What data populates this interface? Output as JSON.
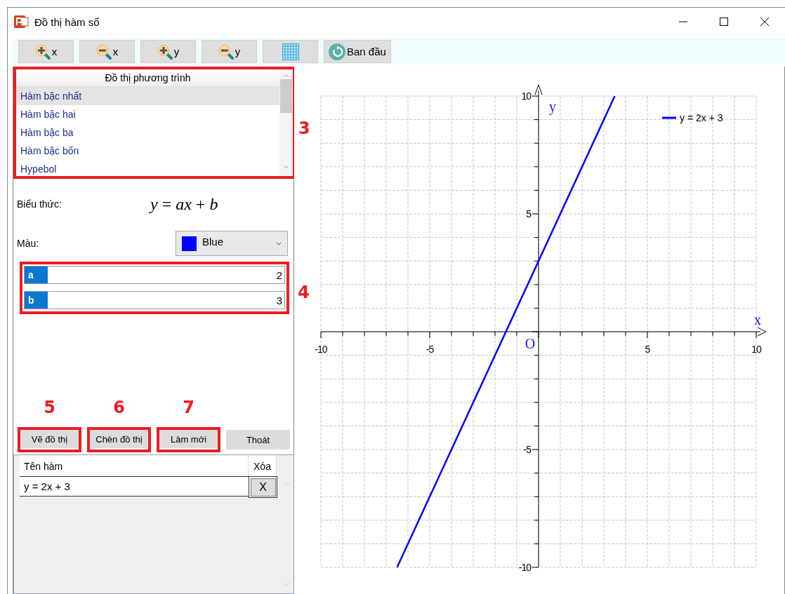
{
  "window": {
    "title": "Đồ thị hàm số"
  },
  "toolbar": [
    {
      "kind": "zoom-in",
      "label": "x"
    },
    {
      "kind": "zoom-out",
      "label": "x"
    },
    {
      "kind": "zoom-in",
      "label": "y"
    },
    {
      "kind": "zoom-out",
      "label": "y"
    },
    {
      "kind": "grid"
    },
    {
      "kind": "reset",
      "label": "Ban đầu"
    }
  ],
  "function_list": {
    "header": "Đồ thị phương trình",
    "annotation": "3",
    "items": [
      {
        "label": "Hàm bậc nhất",
        "selected": true
      },
      {
        "label": "Hàm bậc hai",
        "selected": false
      },
      {
        "label": "Hàm bậc ba",
        "selected": false
      },
      {
        "label": "Hàm bậc bốn",
        "selected": false
      },
      {
        "label": "Hypebol",
        "selected": false
      }
    ]
  },
  "expression": {
    "label": "Biểu thức:",
    "formula": "*y* = *ax* + *b*"
  },
  "color_field": {
    "label": "Màu:",
    "value": "Blue",
    "color": "#0000ff"
  },
  "parameters": {
    "annotation": "4",
    "items": [
      {
        "name": "a",
        "value": "2"
      },
      {
        "name": "b",
        "value": "3"
      }
    ]
  },
  "buttons": [
    {
      "label": "Vẽ đồ thị",
      "annotation": "5"
    },
    {
      "label": "Chèn đồ thị",
      "annotation": "6"
    },
    {
      "label": "Làm mới",
      "annotation": "7"
    },
    {
      "label": "Thoát"
    }
  ],
  "graph_table": {
    "columns": [
      "Tên hàm",
      "Xóa"
    ],
    "rows": [
      {
        "name": "y = 2x + 3",
        "delete": "X"
      }
    ]
  },
  "plot": {
    "origin_label": "O",
    "chart_data": {
      "type": "line",
      "grid": true,
      "xlabel": "x",
      "ylabel": "y",
      "x": [
        -6.5,
        3.5
      ],
      "xlim": [
        -10,
        10
      ],
      "ylim": [
        -10,
        10
      ],
      "xticks": [
        -10,
        -5,
        5,
        10
      ],
      "yticks": [
        -10,
        -5,
        5,
        10
      ],
      "series": [
        {
          "name": "y = 2x + 3",
          "color": "#0000ff",
          "values": [
            -10,
            10
          ]
        }
      ]
    }
  }
}
